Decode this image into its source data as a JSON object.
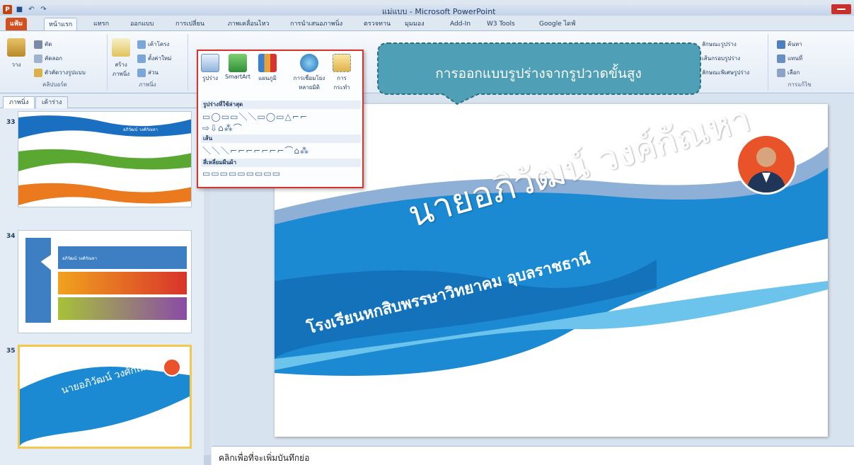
{
  "window": {
    "title": "แม่แบบ - Microsoft PowerPoint"
  },
  "quick_access": {
    "logo": "P",
    "save": "■",
    "undo": "↶",
    "redo": "↷"
  },
  "tabs": [
    {
      "label": "แฟ้ม"
    },
    {
      "label": "หน้าแรก"
    },
    {
      "label": "แทรก"
    },
    {
      "label": "ออกแบบ"
    },
    {
      "label": "การเปลี่ยน"
    },
    {
      "label": "ภาพเคลื่อนไหว"
    },
    {
      "label": "การนำเสนอภาพนิ่ง"
    },
    {
      "label": "ตรวจทาน"
    },
    {
      "label": "มุมมอง"
    },
    {
      "label": "Add-In"
    },
    {
      "label": "W3 Tools"
    },
    {
      "label": "Google ไดฟ์"
    }
  ],
  "ribbon": {
    "clipboard": {
      "label": "คลิปบอร์ด",
      "paste": "วาง",
      "cut": "ตัด",
      "copy": "คัดลอก",
      "format_painter": "ตัวคัดวางรูปแบบ"
    },
    "slides": {
      "label": "ภาพนิ่ง",
      "new_slide": "สร้าง ภาพนิ่ง",
      "layout": "เค้าโครง",
      "reset": "ตั้งค่าใหม่",
      "section": "ส่วน"
    },
    "drawing": {
      "shape_style": "ลักษณะรูปร่าง",
      "shape_outline": "เส้นกรอบรูปร่าง",
      "shape_effects": "ลักษณะพิเศษรูปร่าง"
    },
    "editing": {
      "label": "การแก้ไข",
      "find": "ค้นหา",
      "replace": "แทนที่",
      "select": "เลือก"
    }
  },
  "shapes_menu": {
    "buttons": [
      {
        "label": "รูปร่าง"
      },
      {
        "label": "SmartArt"
      },
      {
        "label": "แผนภูมิ"
      },
      {
        "label": "การเชื่อมโยง หลายมิติ"
      },
      {
        "label": "การ กระทำ"
      }
    ],
    "recent_heading": "รูปร่างที่ใช้ล่าสุด",
    "recent_row1": "▭◯▭▭＼＼▭◯▭△⌐⌐",
    "recent_row2": "⇨⇩⌂⁂⌒",
    "lines_heading": "เส้น",
    "lines_row": "＼＼＼⌐⌐⌐⌐⌐⌐⌐⌒⌂⁂",
    "rect_heading": "สี่เหลี่ยมผืนผ้า",
    "rect_row": "▭▭▭▭▭▭▭▭▭"
  },
  "callout": {
    "text": "การออกแบบรูปร่างจากรูปวาดขั้นสูง"
  },
  "panel": {
    "tab_slides": "ภาพนิ่ง",
    "tab_outline": "เค้าร่าง",
    "slides": [
      {
        "number": "33",
        "caption": "อภิวัฒน์ วงศ์กัณหา"
      },
      {
        "number": "34",
        "caption": "อภิวัฒน์ วงศ์กัณหา"
      },
      {
        "number": "35",
        "caption": "นายอภิวัฒน์ วงศ์กัณหา"
      }
    ]
  },
  "slide": {
    "name": "นายอภิวัฒน์ วงศ์กัณหา",
    "school": "โรงเรียนหกสิบพรรษาวิทยาคม อุบลราชธานี"
  },
  "notes": {
    "placeholder": "คลิกเพื่อที่จะเพิ่มบันทึกย่อ"
  },
  "colors": {
    "file_tab": "#d2501e",
    "wave_blue": "#1b8ad3",
    "callout": "#4fa0b6",
    "highlight_border": "#d9342b",
    "avatar_ring": "#e9532a"
  }
}
